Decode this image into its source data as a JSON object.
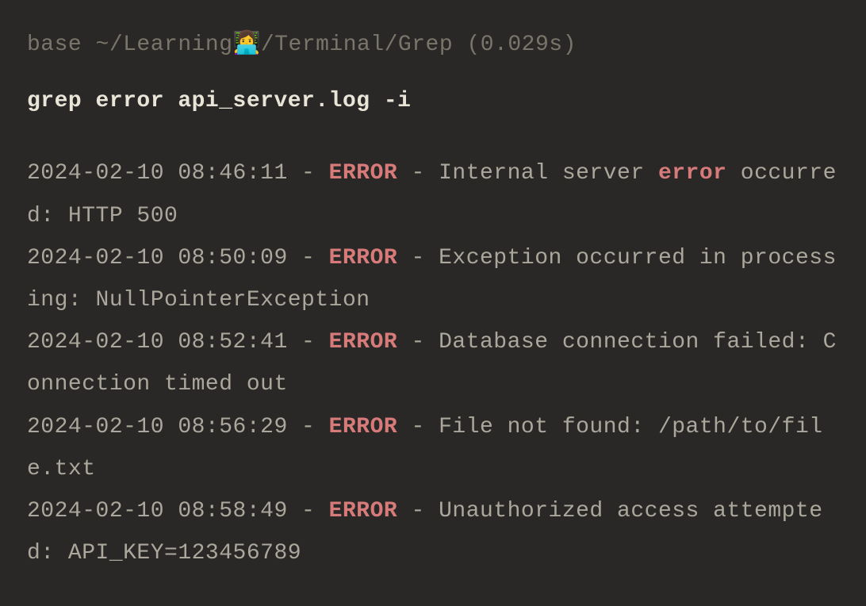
{
  "prompt": "base ~/Learning👩‍💻/Terminal/Grep (0.029s)",
  "command": "grep error api_server.log -i",
  "output_lines": [
    {
      "prefix": "2024-02-10 08:46:11 - ",
      "match1": "ERROR",
      "mid": " - Internal server ",
      "match2": "error",
      "suffix": " occurred: HTTP 500"
    },
    {
      "prefix": "2024-02-10 08:50:09 - ",
      "match1": "ERROR",
      "mid": " - Exception occurred in processing: NullPointerException",
      "match2": "",
      "suffix": ""
    },
    {
      "prefix": "2024-02-10 08:52:41 - ",
      "match1": "ERROR",
      "mid": " - Database connection failed: Connection timed out",
      "match2": "",
      "suffix": ""
    },
    {
      "prefix": "2024-02-10 08:56:29 - ",
      "match1": "ERROR",
      "mid": " - File not found: /path/to/file.txt",
      "match2": "",
      "suffix": ""
    },
    {
      "prefix": "2024-02-10 08:58:49 - ",
      "match1": "ERROR",
      "mid": " - Unauthorized access attempted: API_KEY=123456789",
      "match2": "",
      "suffix": ""
    }
  ]
}
